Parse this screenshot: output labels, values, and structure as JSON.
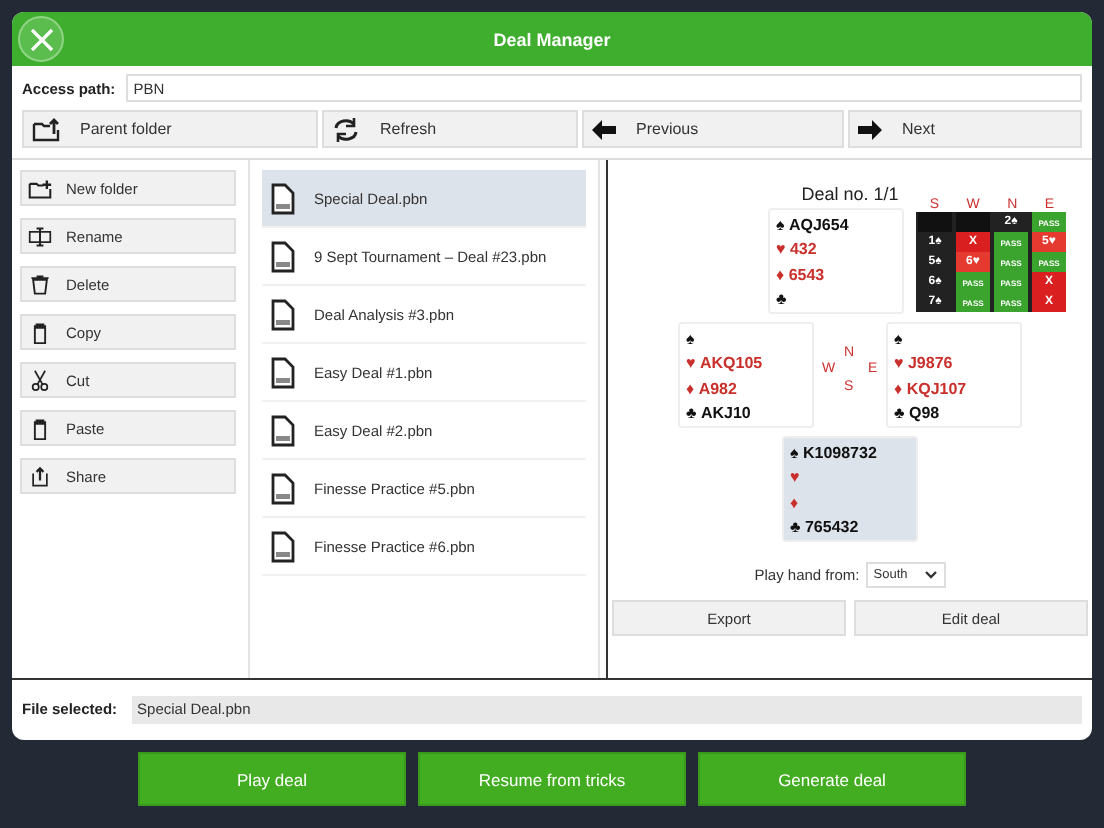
{
  "window": {
    "title": "Deal Manager"
  },
  "access_path": {
    "label": "Access path:",
    "value": "PBN"
  },
  "toolbar": [
    {
      "label": "Parent folder"
    },
    {
      "label": "Refresh"
    },
    {
      "label": "Previous"
    },
    {
      "label": "Next"
    }
  ],
  "actions": [
    {
      "label": "New folder"
    },
    {
      "label": "Rename"
    },
    {
      "label": "Delete"
    },
    {
      "label": "Copy"
    },
    {
      "label": "Cut"
    },
    {
      "label": "Paste"
    },
    {
      "label": "Share"
    }
  ],
  "files": [
    {
      "name": "Special Deal.pbn",
      "selected": true
    },
    {
      "name": "9 Sept Tournament – Deal #23.pbn",
      "selected": false
    },
    {
      "name": "Deal Analysis #3.pbn",
      "selected": false
    },
    {
      "name": "Easy Deal #1.pbn",
      "selected": false
    },
    {
      "name": "Easy Deal #2.pbn",
      "selected": false
    },
    {
      "name": "Finesse Practice #5.pbn",
      "selected": false
    },
    {
      "name": "Finesse Practice #6.pbn",
      "selected": false
    }
  ],
  "deal": {
    "title": "Deal no. 1/1",
    "hands": {
      "north": {
        "selected": false,
        "suits": [
          {
            "symbol": "♠",
            "cards": "AQJ654"
          },
          {
            "symbol": "♥",
            "cards": "432"
          },
          {
            "symbol": "♦",
            "cards": "6543"
          },
          {
            "symbol": "♣"
          }
        ]
      },
      "west": {
        "selected": false,
        "suits": [
          {
            "symbol": "♠"
          },
          {
            "symbol": "♥",
            "cards": "AKQ105"
          },
          {
            "symbol": "♦",
            "cards": "A982"
          },
          {
            "symbol": "♣",
            "cards": "AKJ10"
          }
        ]
      },
      "east": {
        "selected": false,
        "suits": [
          {
            "symbol": "♠"
          },
          {
            "symbol": "♥",
            "cards": "J9876"
          },
          {
            "symbol": "♦",
            "cards": "KQJ107"
          },
          {
            "symbol": "♣",
            "cards": "Q98"
          }
        ]
      },
      "south": {
        "selected": true,
        "suits": [
          {
            "symbol": "♠",
            "cards": "K1098732"
          },
          {
            "symbol": "♥"
          },
          {
            "symbol": "♦"
          },
          {
            "symbol": "♣",
            "cards": "765432"
          }
        ]
      }
    },
    "compass": {
      "north": "N",
      "west": "W",
      "east": "E",
      "south": "S"
    },
    "bidding": {
      "columns": [
        "S",
        "W",
        "N",
        "E"
      ],
      "rows": [
        [
          {
            "kind": "empty"
          },
          {
            "kind": "empty"
          },
          {
            "kind": "bid",
            "text": "2♠"
          },
          {
            "kind": "pass",
            "text": "PASS"
          }
        ],
        [
          {
            "kind": "bid",
            "text": "1♠"
          },
          {
            "kind": "double",
            "text": "X"
          },
          {
            "kind": "pass",
            "text": "PASS"
          },
          {
            "kind": "redbid",
            "text": "5♥"
          }
        ],
        [
          {
            "kind": "bid",
            "text": "5♠"
          },
          {
            "kind": "redbid",
            "text": "6♥"
          },
          {
            "kind": "pass",
            "text": "PASS"
          },
          {
            "kind": "pass",
            "text": "PASS"
          }
        ],
        [
          {
            "kind": "bid",
            "text": "6♠"
          },
          {
            "kind": "pass",
            "text": "PASS"
          },
          {
            "kind": "pass",
            "text": "PASS"
          },
          {
            "kind": "double",
            "text": "X"
          }
        ],
        [
          {
            "kind": "bid",
            "text": "7♠"
          },
          {
            "kind": "pass",
            "text": "PASS"
          },
          {
            "kind": "pass",
            "text": "PASS"
          },
          {
            "kind": "double",
            "text": "X"
          }
        ]
      ]
    },
    "play_from": {
      "label": "Play hand from:",
      "value": "South"
    },
    "buttons": [
      "Export",
      "Edit deal"
    ]
  },
  "file_selected": {
    "label": "File selected:",
    "value": "Special Deal.pbn"
  },
  "bottom_buttons": [
    "Play deal",
    "Resume from tricks",
    "Generate deal"
  ]
}
